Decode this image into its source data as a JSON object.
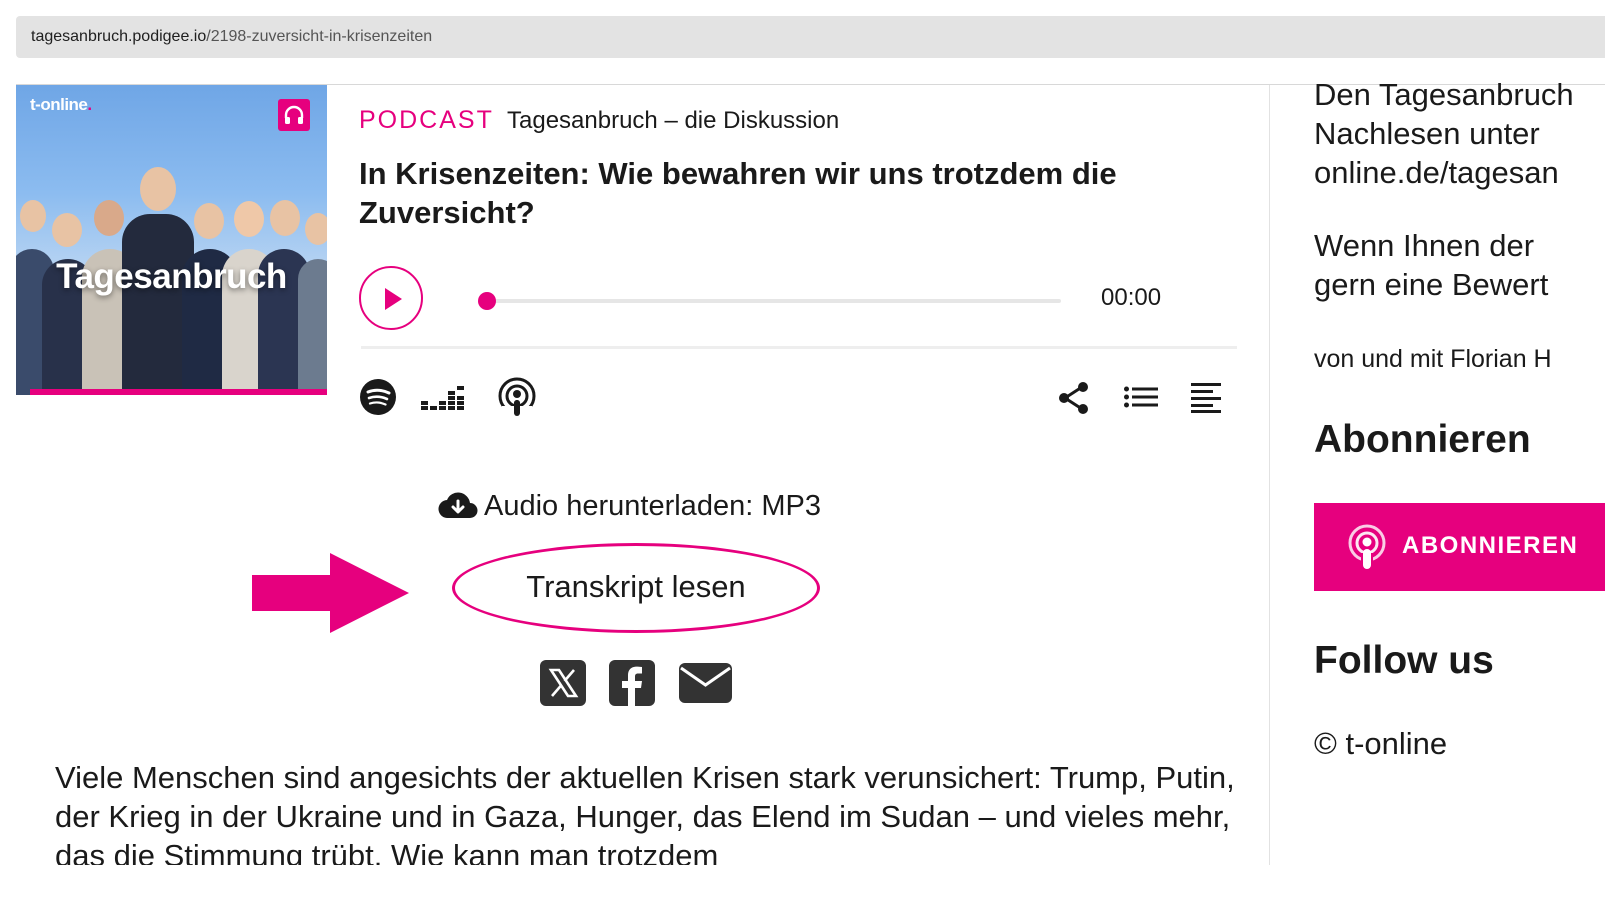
{
  "browser": {
    "url_domain": "tagesanbruch.podigee.io",
    "url_path": "/2198-zuversicht-in-krisenzeiten"
  },
  "cover": {
    "brand": "t-online",
    "brand_dot": ".",
    "show_title": "Tagesanbruch",
    "icon": "headphones-icon"
  },
  "header": {
    "kicker": "PODCAST",
    "show_name": "Tagesanbruch – die Diskussion",
    "episode_title": "In Krisenzeiten: Wie bewahren wir uns trotzdem die Zuversicht?"
  },
  "player": {
    "time": "00:00",
    "progress_fraction": 0.0,
    "play_icon": "play-icon"
  },
  "platforms": [
    "spotify-icon",
    "deezer-icon",
    "apple-podcasts-icon"
  ],
  "actions": [
    "share-icon",
    "chapters-list-icon",
    "transcript-icon"
  ],
  "download": {
    "label": "Audio herunterladen: MP3"
  },
  "transcript": {
    "label": "Transkript lesen"
  },
  "share_buttons": [
    "x-icon",
    "facebook-icon",
    "email-icon"
  ],
  "description": "Viele Menschen sind angesichts der aktuellen Krisen stark verunsichert: Trump, Putin, der Krieg in der Ukraine und in Gaza, Hunger, das Elend im Sudan – und vieles mehr, das die Stimmung trübt. Wie kann man trotzdem",
  "sidebar": {
    "text_lines": [
      "Den Tagesanbruch",
      "Nachlesen unter",
      "online.de/tagesan",
      "Wenn Ihnen der",
      "gern eine Bewert"
    ],
    "credit": "von und mit Florian H",
    "subscribe_heading": "Abonnieren",
    "subscribe_button": "ABONNIEREN",
    "follow_heading": "Follow us",
    "copyright": "© t-online"
  },
  "colors": {
    "accent": "#e6007e",
    "text": "#1a1a1a",
    "urlbar": "#e3e3e3"
  }
}
